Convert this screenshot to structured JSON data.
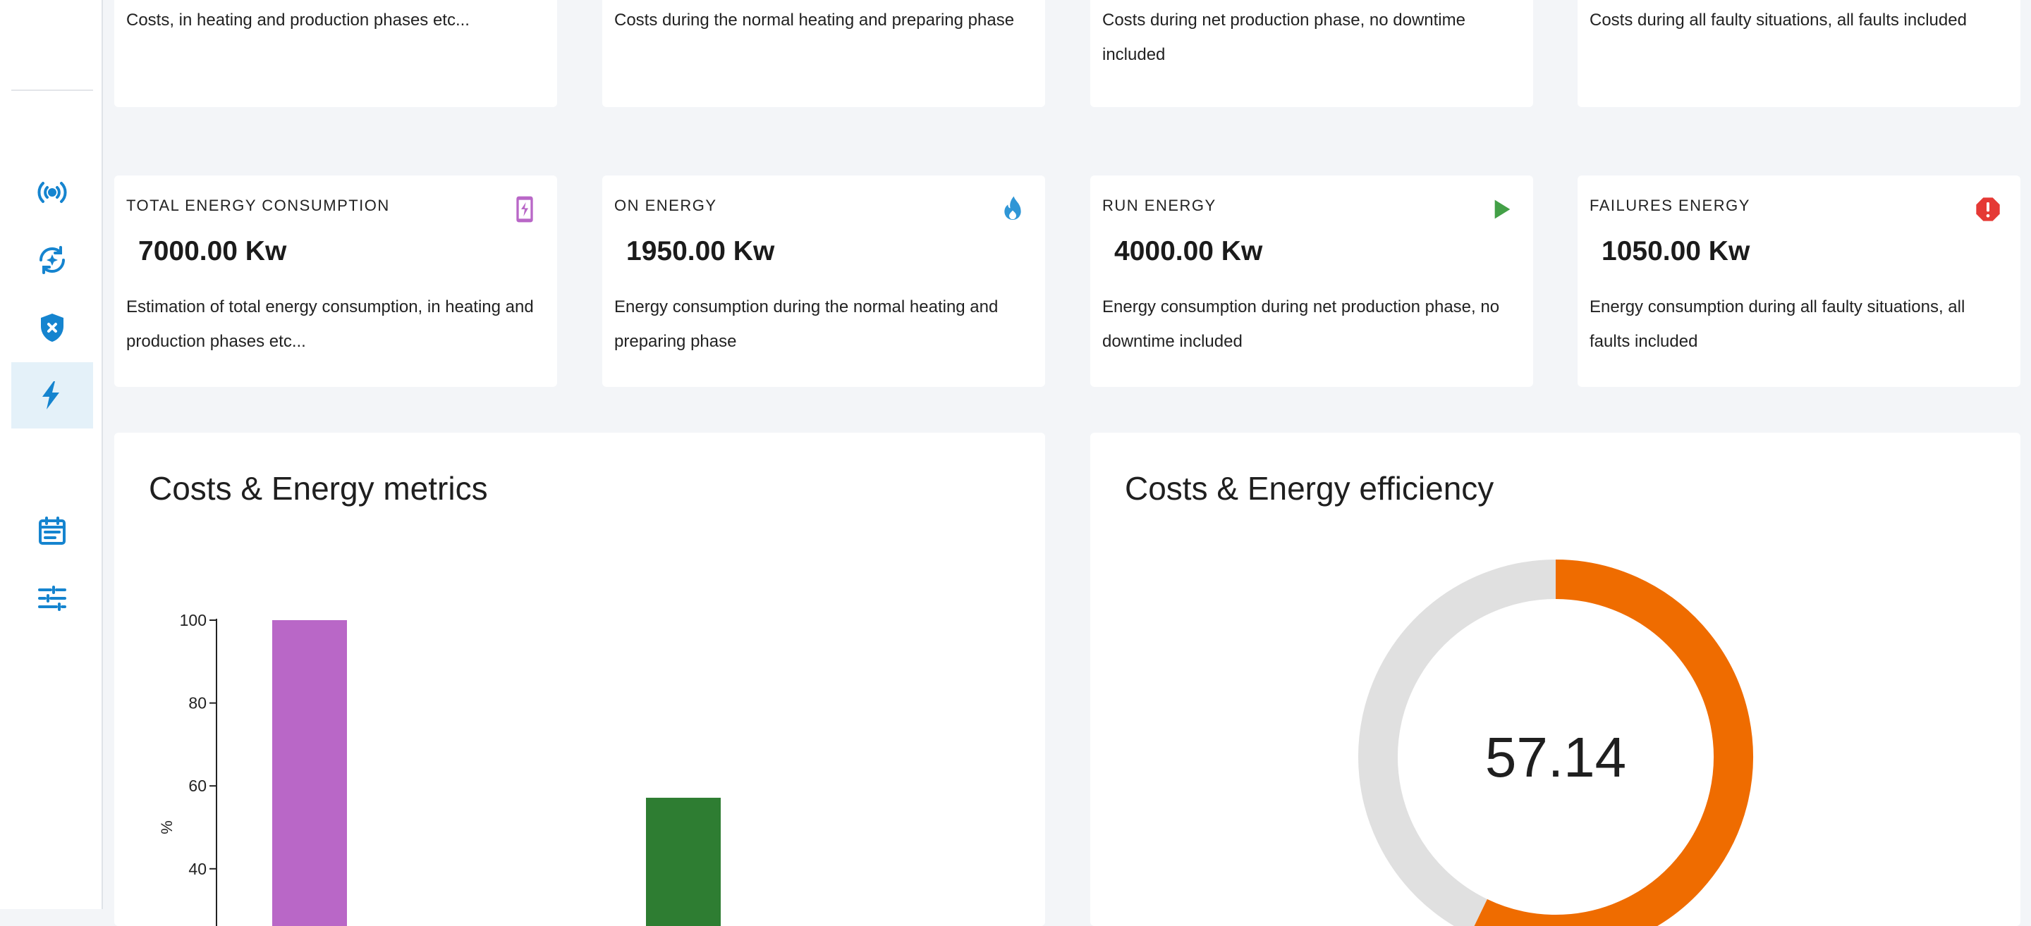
{
  "top_cards": [
    {
      "desc": "Costs, in heating and production phases etc..."
    },
    {
      "desc": "Costs during the normal heating and preparing phase"
    },
    {
      "desc": "Costs during net production phase, no downtime included"
    },
    {
      "desc": "Costs during all faulty situations, all faults included"
    }
  ],
  "energy_cards": [
    {
      "title": "TOTAL ENERGY CONSUMPTION",
      "value": "7000.00 Kw",
      "desc": "Estimation of total energy consumption, in heating and production phases etc...",
      "icon": "phone-charging-icon",
      "color": "#b967c7"
    },
    {
      "title": "ON ENERGY",
      "value": "1950.00 Kw",
      "desc": "Energy consumption during the normal heating and preparing phase",
      "icon": "flame-icon",
      "color": "#2f96d6"
    },
    {
      "title": "RUN ENERGY",
      "value": "4000.00 Kw",
      "desc": "Energy consumption during net production phase, no downtime included",
      "icon": "play-icon",
      "color": "#43a047"
    },
    {
      "title": "FAILURES ENERGY",
      "value": "1050.00 Kw",
      "desc": "Energy consumption during all faulty situations, all faults included",
      "icon": "error-icon",
      "color": "#e53935"
    }
  ],
  "sidebar": {
    "items": [
      {
        "icon": "broadcast-icon",
        "active": false
      },
      {
        "icon": "sync-sparkle-icon",
        "active": false
      },
      {
        "icon": "shield-x-icon",
        "active": false
      },
      {
        "icon": "lightning-icon",
        "active": true
      },
      {
        "icon": "calendar-icon",
        "active": false
      },
      {
        "icon": "sliders-icon",
        "active": false
      }
    ],
    "accent": "#1584cf"
  },
  "metrics_panel": {
    "title": "Costs & Energy metrics"
  },
  "efficiency_panel": {
    "title": "Costs & Energy efficiency",
    "value": "57.14"
  },
  "chart_data": [
    {
      "type": "bar",
      "ylabel": "%",
      "yticks": [
        40,
        60,
        80,
        100
      ],
      "ylim": [
        0,
        100
      ],
      "series": [
        {
          "values": [
            100,
            57.14
          ]
        }
      ],
      "colors": [
        "#b967c7",
        "#2e7d32"
      ]
    },
    {
      "type": "pie",
      "values": [
        57.14,
        42.86
      ],
      "colors": [
        "#ef6c00",
        "#e0e0e0"
      ],
      "center_label": "57.14"
    }
  ]
}
